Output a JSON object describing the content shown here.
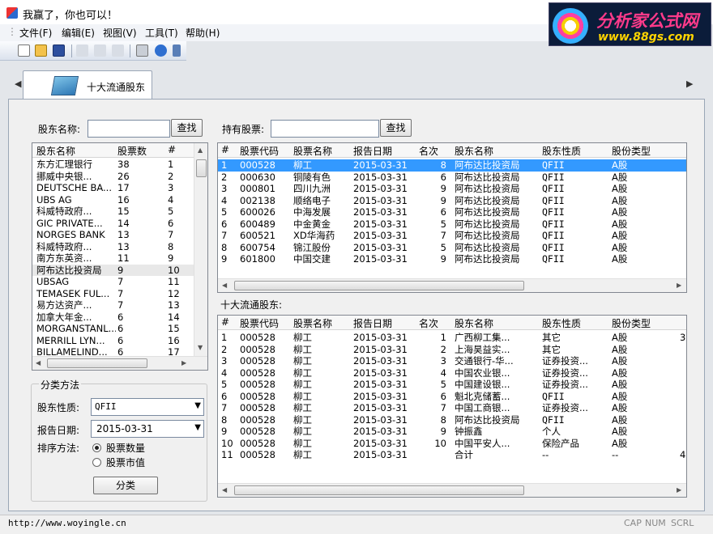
{
  "window": {
    "title": "我赢了，你也可以！"
  },
  "logo": {
    "name": "分析家公式网",
    "url": "www.88gs.com"
  },
  "menu": [
    "文件(F)",
    "编辑(E)",
    "视图(V)",
    "工具(T)",
    "帮助(H)"
  ],
  "toolbar": [
    "new-file-icon",
    "open-folder-icon",
    "save-icon",
    "cut-icon",
    "copy-icon",
    "paste-icon",
    "print-icon",
    "help-icon"
  ],
  "tab": {
    "label": "十大流通股东"
  },
  "left": {
    "holder_label": "股东名称:",
    "holder_value": "",
    "search_btn": "查找",
    "grid": {
      "headers": [
        "股东名称",
        "股票数",
        "#"
      ],
      "rows": [
        [
          "东方汇理银行",
          "38",
          "1"
        ],
        [
          "挪威中央银...",
          "26",
          "2"
        ],
        [
          "DEUTSCHE BA...",
          "17",
          "3"
        ],
        [
          "UBS AG",
          "16",
          "4"
        ],
        [
          "科威特政府...",
          "15",
          "5"
        ],
        [
          "GIC PRIVATE...",
          "14",
          "6"
        ],
        [
          "NORGES BANK",
          "13",
          "7"
        ],
        [
          "科威特政府...",
          "13",
          "8"
        ],
        [
          "南方东英资...",
          "11",
          "9"
        ],
        [
          "阿布达比投资局",
          "9",
          "10"
        ],
        [
          "UBSAG",
          "7",
          "11"
        ],
        [
          "TEMASEK FUL...",
          "7",
          "12"
        ],
        [
          "易方达资产...",
          "7",
          "13"
        ],
        [
          "加拿大年金...",
          "6",
          "14"
        ],
        [
          "MORGANSTANL...",
          "6",
          "15"
        ],
        [
          "MERRILL LYN...",
          "6",
          "16"
        ],
        [
          "BILLAMELIND...",
          "6",
          "17"
        ]
      ]
    }
  },
  "filter": {
    "group_title": "分类方法",
    "type_label": "股东性质:",
    "type_value": "QFII",
    "date_label": "报告日期:",
    "date_value": "2015-03-31",
    "sort_label": "排序方法:",
    "sort_options": [
      "股票数量",
      "股票市值"
    ],
    "sort_selected": 0,
    "classify_btn": "分类"
  },
  "stock": {
    "label": "持有股票:",
    "value": "",
    "search_btn": "查找",
    "headers": [
      "#",
      "股票代码",
      "股票名称",
      "报告日期",
      "名次",
      "股东名称",
      "股东性质",
      "股份类型"
    ],
    "rows": [
      [
        "1",
        "000528",
        "柳工",
        "2015-03-31",
        "8",
        "阿布达比投资局",
        "QFII",
        "A股"
      ],
      [
        "2",
        "000630",
        "铜陵有色",
        "2015-03-31",
        "6",
        "阿布达比投资局",
        "QFII",
        "A股"
      ],
      [
        "3",
        "000801",
        "四川九洲",
        "2015-03-31",
        "9",
        "阿布达比投资局",
        "QFII",
        "A股"
      ],
      [
        "4",
        "002138",
        "顺络电子",
        "2015-03-31",
        "9",
        "阿布达比投资局",
        "QFII",
        "A股"
      ],
      [
        "5",
        "600026",
        "中海发展",
        "2015-03-31",
        "6",
        "阿布达比投资局",
        "QFII",
        "A股"
      ],
      [
        "6",
        "600489",
        "中金黄金",
        "2015-03-31",
        "5",
        "阿布达比投资局",
        "QFII",
        "A股"
      ],
      [
        "7",
        "600521",
        "XD华海药",
        "2015-03-31",
        "7",
        "阿布达比投资局",
        "QFII",
        "A股"
      ],
      [
        "8",
        "600754",
        "锦江股份",
        "2015-03-31",
        "5",
        "阿布达比投资局",
        "QFII",
        "A股"
      ],
      [
        "9",
        "601800",
        "中国交建",
        "2015-03-31",
        "9",
        "阿布达比投资局",
        "QFII",
        "A股"
      ]
    ]
  },
  "top10": {
    "label": "十大流通股东:",
    "headers": [
      "#",
      "股票代码",
      "股票名称",
      "报告日期",
      "名次",
      "股东名称",
      "股东性质",
      "股份类型"
    ],
    "rows": [
      [
        "1",
        "000528",
        "柳工",
        "2015-03-31",
        "1",
        "广西柳工集...",
        "其它",
        "A股",
        "3"
      ],
      [
        "2",
        "000528",
        "柳工",
        "2015-03-31",
        "2",
        "上海昊益实...",
        "其它",
        "A股",
        ""
      ],
      [
        "3",
        "000528",
        "柳工",
        "2015-03-31",
        "3",
        "交通银行-华...",
        "证券投资...",
        "A股",
        ""
      ],
      [
        "4",
        "000528",
        "柳工",
        "2015-03-31",
        "4",
        "中国农业银...",
        "证券投资...",
        "A股",
        ""
      ],
      [
        "5",
        "000528",
        "柳工",
        "2015-03-31",
        "5",
        "中国建设银...",
        "证券投资...",
        "A股",
        ""
      ],
      [
        "6",
        "000528",
        "柳工",
        "2015-03-31",
        "6",
        "魁北克储蓄...",
        "QFII",
        "A股",
        ""
      ],
      [
        "7",
        "000528",
        "柳工",
        "2015-03-31",
        "7",
        "中国工商银...",
        "证券投资...",
        "A股",
        ""
      ],
      [
        "8",
        "000528",
        "柳工",
        "2015-03-31",
        "8",
        "阿布达比投资局",
        "QFII",
        "A股",
        ""
      ],
      [
        "9",
        "000528",
        "柳工",
        "2015-03-31",
        "9",
        "钟振鑫",
        "个人",
        "A股",
        ""
      ],
      [
        "10",
        "000528",
        "柳工",
        "2015-03-31",
        "10",
        "中国平安人...",
        "保险产品",
        "A股",
        ""
      ],
      [
        "11",
        "000528",
        "柳工",
        "2015-03-31",
        "",
        "合计",
        "--",
        "--",
        "4"
      ]
    ]
  },
  "status": {
    "url": "http://www.woyingle.cn",
    "panels": [
      "CAP",
      "NUM",
      "SCRL"
    ]
  },
  "colors": {
    "selection": "#3399ff",
    "logo_bg": "#0b1c3a",
    "logo_pink": "#ff3a8a",
    "logo_yellow": "#ffd400"
  }
}
